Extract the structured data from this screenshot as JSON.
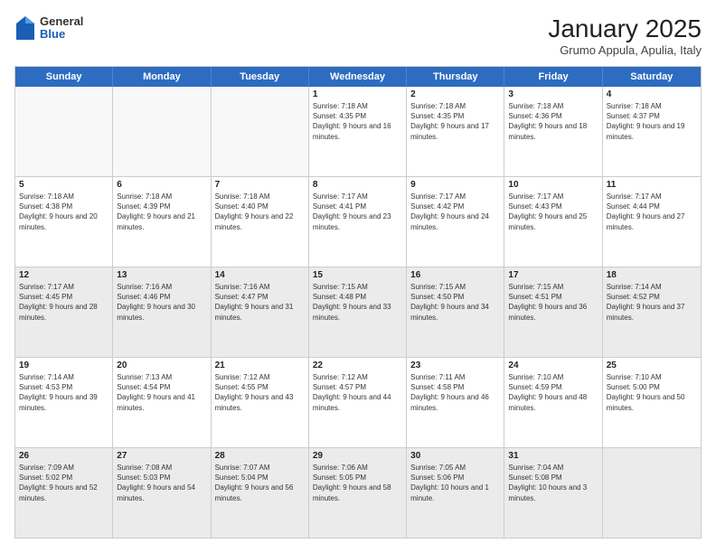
{
  "header": {
    "logo": {
      "general": "General",
      "blue": "Blue"
    },
    "title": "January 2025",
    "subtitle": "Grumo Appula, Apulia, Italy"
  },
  "weekdays": [
    "Sunday",
    "Monday",
    "Tuesday",
    "Wednesday",
    "Thursday",
    "Friday",
    "Saturday"
  ],
  "rows": [
    [
      {
        "day": "",
        "text": "",
        "empty": true
      },
      {
        "day": "",
        "text": "",
        "empty": true
      },
      {
        "day": "",
        "text": "",
        "empty": true
      },
      {
        "day": "1",
        "text": "Sunrise: 7:18 AM\nSunset: 4:35 PM\nDaylight: 9 hours and 16 minutes."
      },
      {
        "day": "2",
        "text": "Sunrise: 7:18 AM\nSunset: 4:35 PM\nDaylight: 9 hours and 17 minutes."
      },
      {
        "day": "3",
        "text": "Sunrise: 7:18 AM\nSunset: 4:36 PM\nDaylight: 9 hours and 18 minutes."
      },
      {
        "day": "4",
        "text": "Sunrise: 7:18 AM\nSunset: 4:37 PM\nDaylight: 9 hours and 19 minutes."
      }
    ],
    [
      {
        "day": "5",
        "text": "Sunrise: 7:18 AM\nSunset: 4:38 PM\nDaylight: 9 hours and 20 minutes."
      },
      {
        "day": "6",
        "text": "Sunrise: 7:18 AM\nSunset: 4:39 PM\nDaylight: 9 hours and 21 minutes."
      },
      {
        "day": "7",
        "text": "Sunrise: 7:18 AM\nSunset: 4:40 PM\nDaylight: 9 hours and 22 minutes."
      },
      {
        "day": "8",
        "text": "Sunrise: 7:17 AM\nSunset: 4:41 PM\nDaylight: 9 hours and 23 minutes."
      },
      {
        "day": "9",
        "text": "Sunrise: 7:17 AM\nSunset: 4:42 PM\nDaylight: 9 hours and 24 minutes."
      },
      {
        "day": "10",
        "text": "Sunrise: 7:17 AM\nSunset: 4:43 PM\nDaylight: 9 hours and 25 minutes."
      },
      {
        "day": "11",
        "text": "Sunrise: 7:17 AM\nSunset: 4:44 PM\nDaylight: 9 hours and 27 minutes."
      }
    ],
    [
      {
        "day": "12",
        "text": "Sunrise: 7:17 AM\nSunset: 4:45 PM\nDaylight: 9 hours and 28 minutes.",
        "shaded": true
      },
      {
        "day": "13",
        "text": "Sunrise: 7:16 AM\nSunset: 4:46 PM\nDaylight: 9 hours and 30 minutes.",
        "shaded": true
      },
      {
        "day": "14",
        "text": "Sunrise: 7:16 AM\nSunset: 4:47 PM\nDaylight: 9 hours and 31 minutes.",
        "shaded": true
      },
      {
        "day": "15",
        "text": "Sunrise: 7:15 AM\nSunset: 4:48 PM\nDaylight: 9 hours and 33 minutes.",
        "shaded": true
      },
      {
        "day": "16",
        "text": "Sunrise: 7:15 AM\nSunset: 4:50 PM\nDaylight: 9 hours and 34 minutes.",
        "shaded": true
      },
      {
        "day": "17",
        "text": "Sunrise: 7:15 AM\nSunset: 4:51 PM\nDaylight: 9 hours and 36 minutes.",
        "shaded": true
      },
      {
        "day": "18",
        "text": "Sunrise: 7:14 AM\nSunset: 4:52 PM\nDaylight: 9 hours and 37 minutes.",
        "shaded": true
      }
    ],
    [
      {
        "day": "19",
        "text": "Sunrise: 7:14 AM\nSunset: 4:53 PM\nDaylight: 9 hours and 39 minutes."
      },
      {
        "day": "20",
        "text": "Sunrise: 7:13 AM\nSunset: 4:54 PM\nDaylight: 9 hours and 41 minutes."
      },
      {
        "day": "21",
        "text": "Sunrise: 7:12 AM\nSunset: 4:55 PM\nDaylight: 9 hours and 43 minutes."
      },
      {
        "day": "22",
        "text": "Sunrise: 7:12 AM\nSunset: 4:57 PM\nDaylight: 9 hours and 44 minutes."
      },
      {
        "day": "23",
        "text": "Sunrise: 7:11 AM\nSunset: 4:58 PM\nDaylight: 9 hours and 46 minutes."
      },
      {
        "day": "24",
        "text": "Sunrise: 7:10 AM\nSunset: 4:59 PM\nDaylight: 9 hours and 48 minutes."
      },
      {
        "day": "25",
        "text": "Sunrise: 7:10 AM\nSunset: 5:00 PM\nDaylight: 9 hours and 50 minutes."
      }
    ],
    [
      {
        "day": "26",
        "text": "Sunrise: 7:09 AM\nSunset: 5:02 PM\nDaylight: 9 hours and 52 minutes.",
        "shaded": true
      },
      {
        "day": "27",
        "text": "Sunrise: 7:08 AM\nSunset: 5:03 PM\nDaylight: 9 hours and 54 minutes.",
        "shaded": true
      },
      {
        "day": "28",
        "text": "Sunrise: 7:07 AM\nSunset: 5:04 PM\nDaylight: 9 hours and 56 minutes.",
        "shaded": true
      },
      {
        "day": "29",
        "text": "Sunrise: 7:06 AM\nSunset: 5:05 PM\nDaylight: 9 hours and 58 minutes.",
        "shaded": true
      },
      {
        "day": "30",
        "text": "Sunrise: 7:05 AM\nSunset: 5:06 PM\nDaylight: 10 hours and 1 minute.",
        "shaded": true
      },
      {
        "day": "31",
        "text": "Sunrise: 7:04 AM\nSunset: 5:08 PM\nDaylight: 10 hours and 3 minutes.",
        "shaded": true
      },
      {
        "day": "",
        "text": "",
        "empty": true,
        "shaded": true
      }
    ]
  ]
}
